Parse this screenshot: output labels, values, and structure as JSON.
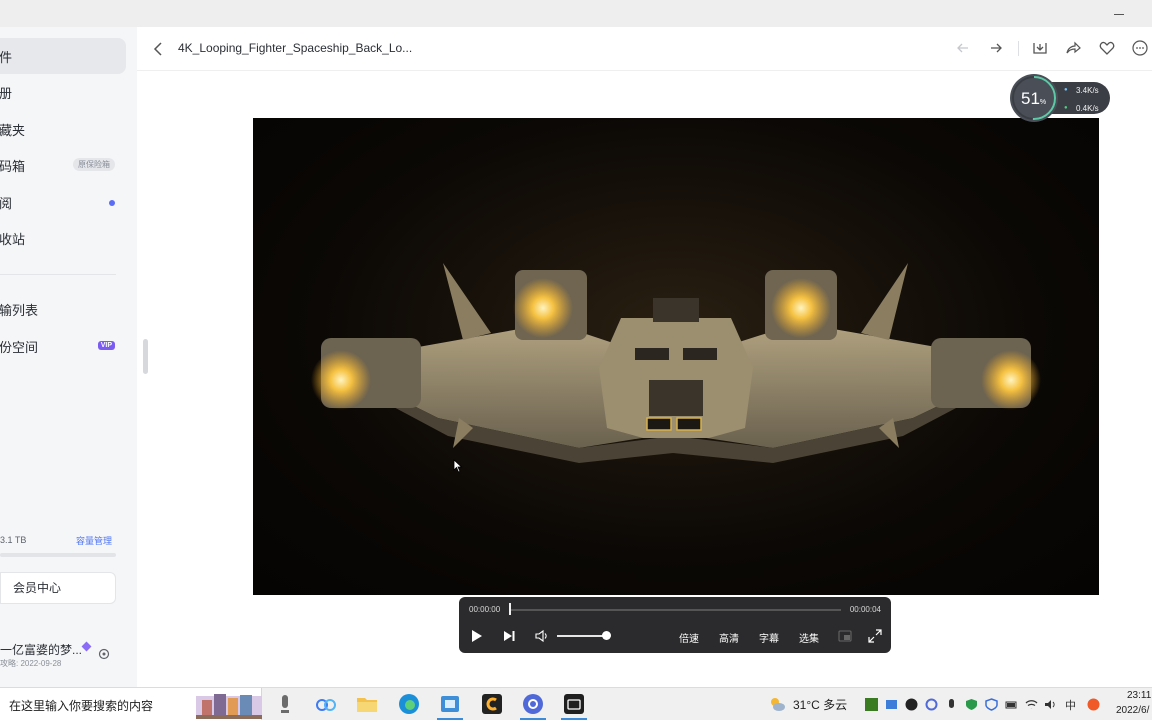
{
  "window": {
    "minimize_icon": "minimize-icon"
  },
  "sidebar": {
    "items": [
      {
        "label": "件",
        "active": true
      },
      {
        "label": "册"
      },
      {
        "label": "藏夹"
      },
      {
        "label": "码箱",
        "tag": "原保险箱"
      },
      {
        "label": "阅",
        "dot": true
      },
      {
        "label": "收站"
      },
      {
        "label": "输列表"
      },
      {
        "label": "份空间",
        "tag": "VIP"
      }
    ],
    "storage": {
      "text": "3.1 TB",
      "link": "容量管理"
    },
    "vip_center": "会员中心",
    "user": {
      "name": "一亿富婆的梦...",
      "sub": "攻略: 2022-09-28"
    }
  },
  "title_bar": {
    "back_icon": "chevron-left-icon",
    "title": "4K_Looping_Fighter_Spaceship_Back_Lo...",
    "actions": [
      "undo-arrow-icon",
      "redo-arrow-icon",
      "download-icon",
      "share-icon",
      "heart-icon",
      "more-icon"
    ]
  },
  "speed_widget": {
    "percent": "51",
    "percent_unit": "%",
    "upload": "3.4K/s",
    "download": "0.4K/s"
  },
  "player": {
    "current_time": "00:00:00",
    "duration": "00:00:04",
    "progress_fraction": 0.0,
    "volume_fraction": 0.9,
    "buttons": {
      "speed": "倍速",
      "quality": "高清",
      "subtitle": "字幕",
      "episodes": "选集"
    }
  },
  "taskbar": {
    "search_placeholder": "在这里输入你要搜索的内容",
    "apps": [
      "mic-app-icon",
      "baidu-netdisk-icon",
      "file-explorer-icon",
      "edge-icon",
      "store-icon",
      "c-app-icon",
      "chrome-like-icon",
      "video-player-app-icon"
    ],
    "weather": "31°C 多云",
    "time": "23:11",
    "date": "2022/6/"
  },
  "colors": {
    "accent": "#4e74f5",
    "vip": "#7b5cf2",
    "dot": "#5b6cf6"
  }
}
